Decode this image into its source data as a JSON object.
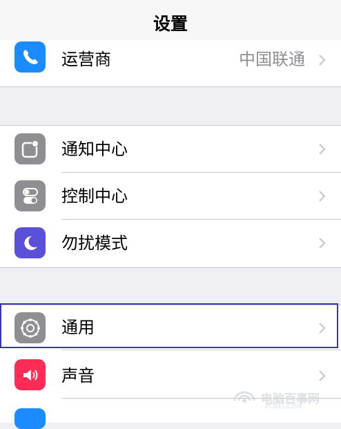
{
  "nav": {
    "title": "设置"
  },
  "sections": {
    "carrier": {
      "label": "运营商",
      "value": "中国联通",
      "icon": "phone-icon",
      "color": "#1a8cff"
    },
    "notifications": {
      "label": "通知中心",
      "icon": "notification-center-icon",
      "color": "#8e8e93"
    },
    "control": {
      "label": "控制中心",
      "icon": "control-center-icon",
      "color": "#8e8e93"
    },
    "dnd": {
      "label": "勿扰模式",
      "icon": "moon-icon",
      "color": "#5b51d8"
    },
    "general": {
      "label": "通用",
      "icon": "gear-icon",
      "color": "#8e8e93"
    },
    "sounds": {
      "label": "声音",
      "icon": "speaker-icon",
      "color": "#ff2d55"
    }
  },
  "highlight_color": "#3536b0",
  "watermark": {
    "text": "电脑百事网",
    "sub": "PC841.COM"
  }
}
